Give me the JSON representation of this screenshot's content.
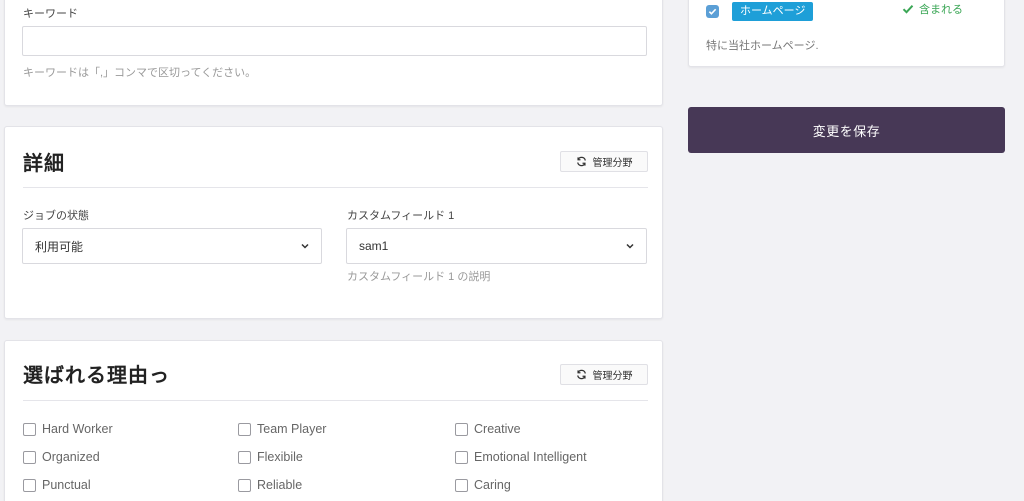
{
  "keyword_card": {
    "label": "キーワード",
    "value": "",
    "help": "キーワードは「,」コンマで区切ってください。"
  },
  "details_card": {
    "title": "詳細",
    "manage_label": "管理分野",
    "job_status": {
      "label": "ジョブの状態",
      "value": "利用可能"
    },
    "custom_field": {
      "label": "カスタムフィールド 1",
      "value": "sam1",
      "help": "カスタムフィールド 1 の説明"
    }
  },
  "reasons_card": {
    "title": "選ばれる理由っ",
    "manage_label": "管理分野",
    "options": [
      [
        "Hard Worker",
        "Team Player",
        "Creative"
      ],
      [
        "Organized",
        "Flexibile",
        "Emotional Intelligent"
      ],
      [
        "Punctual",
        "Reliable",
        "Caring"
      ]
    ]
  },
  "sidebar": {
    "homepage_tag": "ホームページ",
    "included_label": "含まれる",
    "homepage_desc": "特に当社ホームページ.",
    "save_label": "変更を保存"
  },
  "colors": {
    "save_button": "#473856",
    "tag": "#1e9fd8",
    "included": "#3aa655"
  }
}
